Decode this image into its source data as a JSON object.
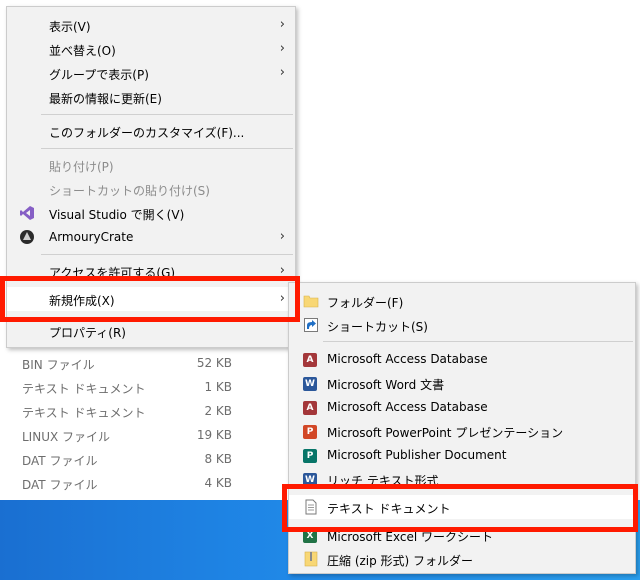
{
  "file_list": [
    {
      "type": "BIN ファイル",
      "size": "52 KB"
    },
    {
      "type": "テキスト ドキュメント",
      "size": "1 KB"
    },
    {
      "type": "テキスト ドキュメント",
      "size": "2 KB"
    },
    {
      "type": "LINUX ファイル",
      "size": "19 KB"
    },
    {
      "type": "DAT ファイル",
      "size": "8 KB"
    },
    {
      "type": "DAT ファイル",
      "size": "4 KB"
    }
  ],
  "context_menu": {
    "view": "表示(V)",
    "sort": "並べ替え(O)",
    "group": "グループで表示(P)",
    "refresh": "最新の情報に更新(E)",
    "customize": "このフォルダーのカスタマイズ(F)...",
    "paste": "貼り付け(P)",
    "paste_shortcut": "ショートカットの貼り付け(S)",
    "vs_open": "Visual Studio で開く(V)",
    "armoury": "ArmouryCrate",
    "access": "アクセスを許可する(G)",
    "new": "新規作成(X)",
    "properties": "プロパティ(R)"
  },
  "new_submenu": {
    "folder": "フォルダー(F)",
    "shortcut": "ショートカット(S)",
    "access_db_1": "Microsoft Access Database",
    "word": "Microsoft Word 文書",
    "access_db_2": "Microsoft Access Database",
    "powerpoint": "Microsoft PowerPoint プレゼンテーション",
    "publisher": "Microsoft Publisher Document",
    "rtf": "リッチ テキスト形式",
    "text_doc": "テキスト ドキュメント",
    "excel": "Microsoft Excel ワークシート",
    "zip": "圧縮 (zip 形式) フォルダー"
  },
  "colors": {
    "highlight_box": "#ff1a00",
    "menu_bg": "#f2f2f2",
    "desktop_blue": "#1f86e6"
  }
}
